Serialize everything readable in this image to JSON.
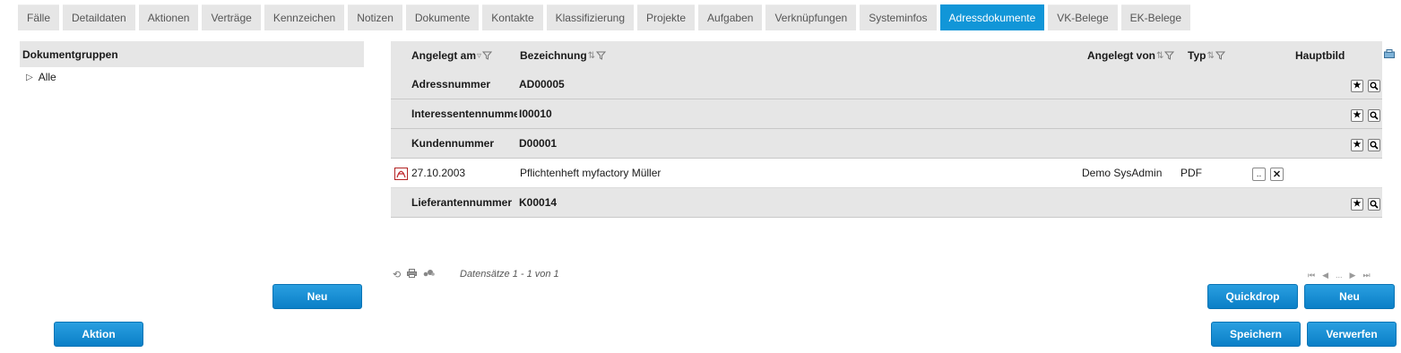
{
  "tabs": [
    "Fälle",
    "Detaildaten",
    "Aktionen",
    "Verträge",
    "Kennzeichen",
    "Notizen",
    "Dokumente",
    "Kontakte",
    "Klassifizierung",
    "Projekte",
    "Aufgaben",
    "Verknüpfungen",
    "Systeminfos",
    "Adressdokumente",
    "VK-Belege",
    "EK-Belege"
  ],
  "active_tab": "Adressdokumente",
  "left_panel": {
    "title": "Dokumentgruppen",
    "tree_item": "Alle",
    "new_button": "Neu"
  },
  "grid": {
    "columns": {
      "angelegt_am": "Angelegt am",
      "bezeichnung": "Bezeichnung",
      "angelegt_von": "Angelegt von",
      "typ": "Typ",
      "hauptbild": "Hauptbild"
    },
    "groups": [
      {
        "label": "Adressnummer",
        "value": "AD00005"
      },
      {
        "label": "Interessentennummer",
        "value": "I00010"
      },
      {
        "label": "Kundennummer",
        "value": "D00001"
      },
      {
        "label": "Lieferantennummer",
        "value": "K00014"
      }
    ],
    "row": {
      "date": "27.10.2003",
      "title": "Pflichtenheft myfactory Müller",
      "author": "Demo SysAdmin",
      "type": "PDF"
    },
    "more_label": "..",
    "delete_label": "✕",
    "star_label": "★",
    "records_text": "Datensätze 1 - 1 von 1",
    "pager_dots": "..."
  },
  "buttons": {
    "quickdrop": "Quickdrop",
    "new": "Neu",
    "action": "Aktion",
    "save": "Speichern",
    "discard": "Verwerfen"
  },
  "colors": {
    "accent": "#1196d8",
    "header_bg": "#e6e6e6"
  }
}
